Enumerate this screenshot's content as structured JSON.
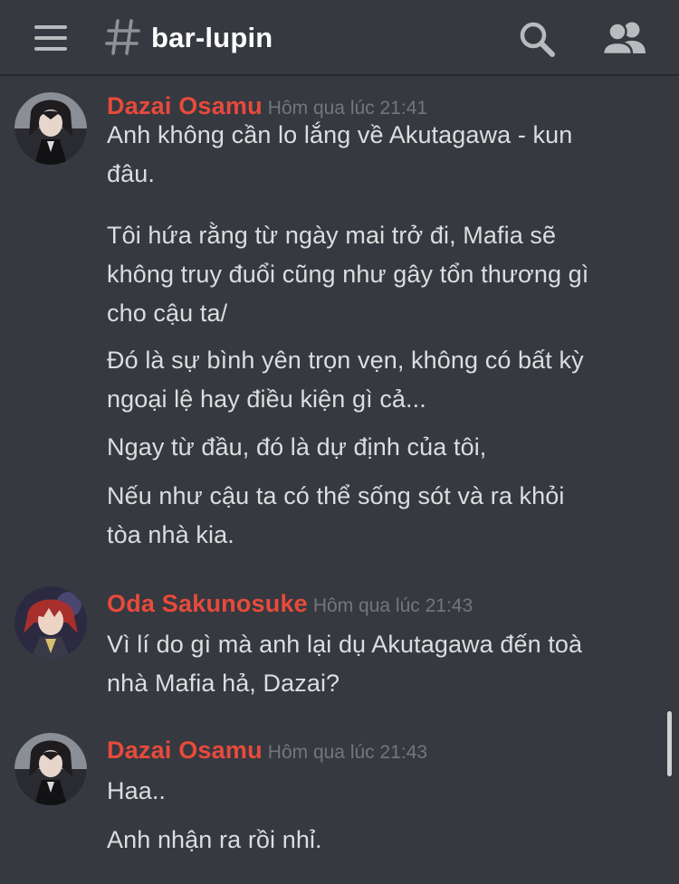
{
  "header": {
    "channel_name": "bar-lupin",
    "menu_icon": "hamburger-menu-icon",
    "channel_icon": "hash-icon",
    "search_icon": "search-icon",
    "members_icon": "members-icon"
  },
  "colors": {
    "background": "#36393f",
    "username": "#e84a3c",
    "timestamp": "#72767d",
    "message_text": "#dcddde",
    "header_text": "#ffffff",
    "icon": "#b9bbbe"
  },
  "messages": [
    {
      "author": "Dazai Osamu",
      "timestamp": "Hôm qua lúc 21:41",
      "lines": [
        "Anh không cần lo lắng về Akutagawa - kun",
        "đâu.",
        "Tôi hứa rằng từ ngày mai trở đi, Mafia sẽ",
        "không truy đuổi cũng như gây tổn thương gì",
        "cho cậu ta/",
        "Đó là sự bình yên trọn vẹn, không có bất kỳ",
        "ngoại lệ hay điều kiện gì cả...",
        "Ngay từ đầu, đó là dự định của tôi,",
        "Nếu như cậu ta có thể sống sót và ra khỏi",
        "tòa nhà kia."
      ]
    },
    {
      "author": "Oda Sakunosuke",
      "timestamp": "Hôm qua lúc 21:43",
      "lines": [
        "Vì lí do gì mà anh lại dụ Akutagawa đến toà",
        "nhà Mafia hả, Dazai?"
      ]
    },
    {
      "author": "Dazai Osamu",
      "timestamp": "Hôm qua lúc 21:43",
      "lines": [
        "Haa..",
        "Anh nhận ra rồi nhỉ."
      ]
    }
  ]
}
